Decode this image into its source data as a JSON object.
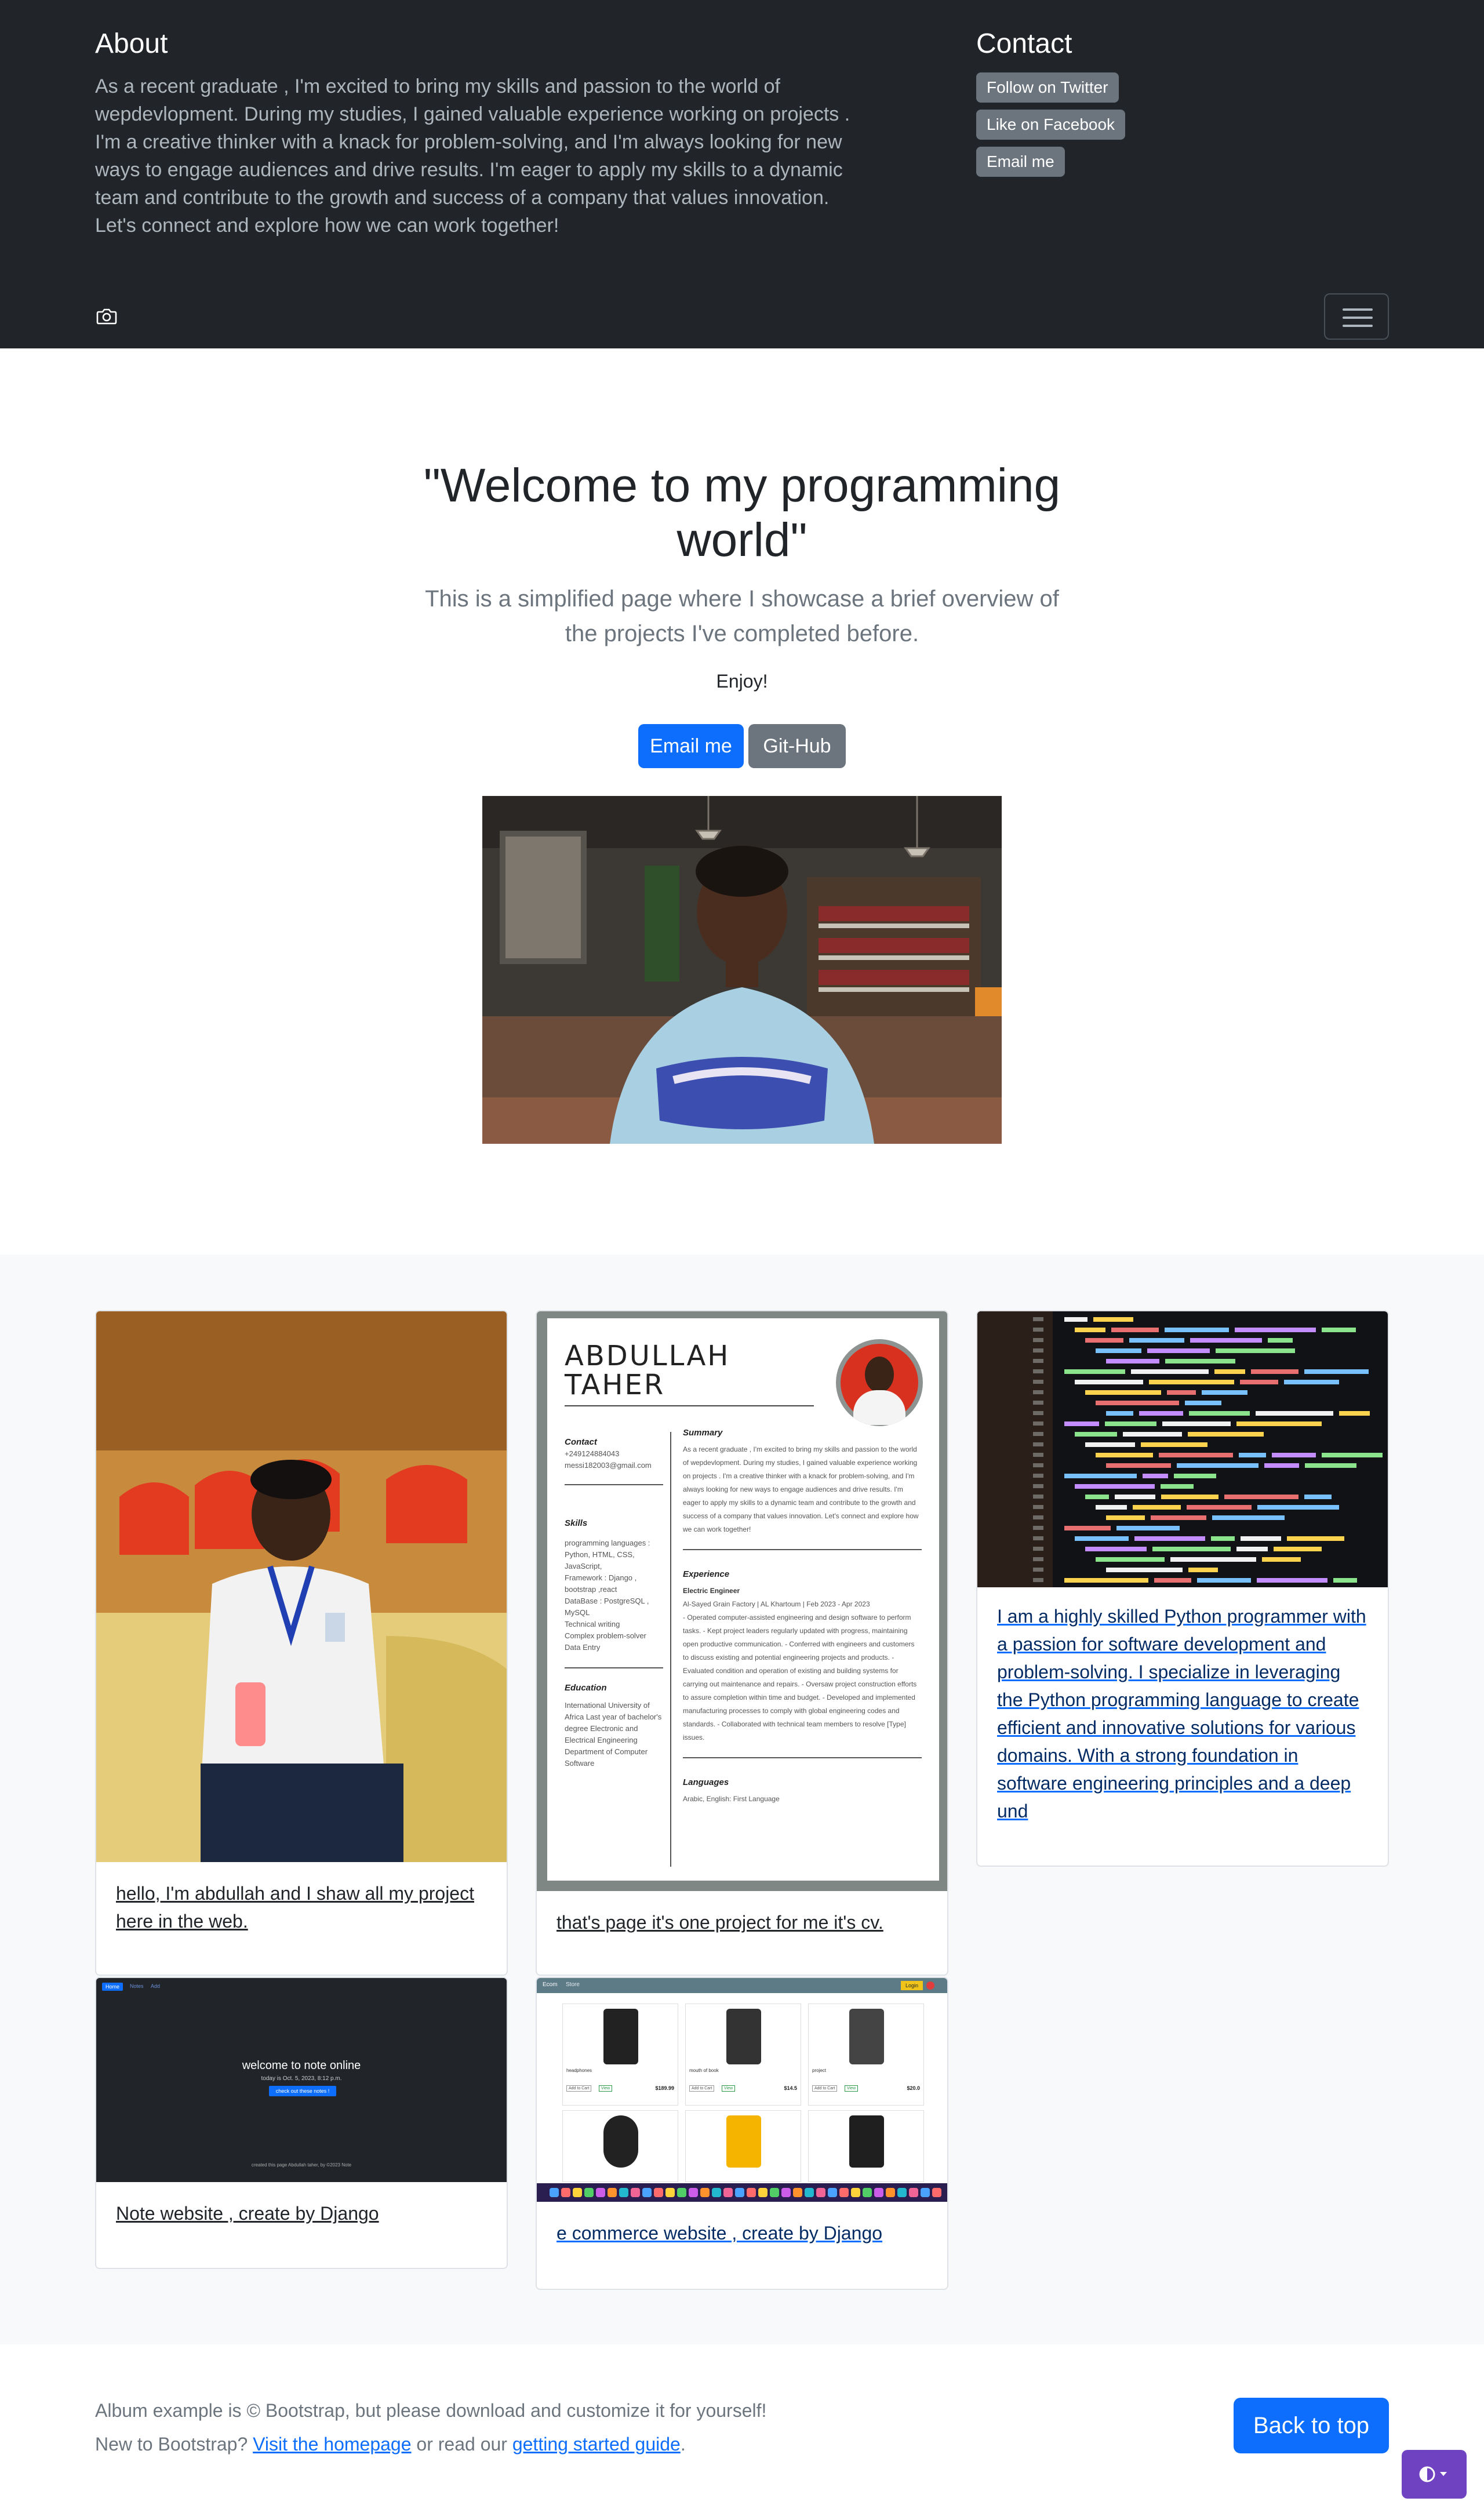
{
  "header": {
    "about_title": "About",
    "about_text": "As a recent graduate , I'm excited to bring my skills and passion to the world of wepdevlopment. During my studies, I gained valuable experience working on projects . I'm a creative thinker with a knack for problem-solving, and I'm always looking for new ways to engage audiences and drive results. I'm eager to apply my skills to a dynamic team and contribute to the growth and success of a company that values innovation. Let's connect and explore how we can work together!",
    "contact_title": "Contact",
    "contact_links": [
      "Follow on Twitter",
      "Like on Facebook",
      "Email me"
    ]
  },
  "hero": {
    "title": "\"Welcome to my programming world\"",
    "lead": "This is a simplified page where I showcase a brief overview of the projects I've completed before.",
    "enjoy": "Enjoy!",
    "email_button": "Email me",
    "github_button": "Git-Hub"
  },
  "cards": [
    {
      "text": "hello, I'm abdullah and I shaw all my project here in the web."
    },
    {
      "text": "that's page it's one project for me it's cv."
    },
    {
      "text": "I am a highly skilled Python programmer with a passion for software development and problem-solving. I specialize in leveraging the Python programming language to create efficient and innovative solutions for various domains. With a strong foundation in software engineering principles and a deep und"
    },
    {
      "text": "Note website , create by Django"
    },
    {
      "text": "e commerce website , create by Django"
    }
  ],
  "cv": {
    "name_line1": "ABDULLAH",
    "name_line2": "TAHER",
    "contact_h": "Contact",
    "contact_phone": "+249124884043",
    "contact_email": "messi182003@gmail.com",
    "skills_h": "Skills",
    "skills": [
      "programming languages : Python, HTML, CSS, JavaScript,",
      "Framework : Django , bootstrap ,react",
      "DataBase : PostgreSQL , MySQL",
      "Technical writing",
      "Complex problem-solver",
      "Data Entry"
    ],
    "education_h": "Education",
    "education": "International University of Africa Last year of bachelor's degree Electronic and Electrical Engineering Department of Computer Software",
    "summary_h": "Summary",
    "summary": "As a recent graduate , I'm excited to bring my skills and passion to the world of wepdevlopment. During my studies, I gained valuable experience working on projects . I'm a creative thinker with a knack for problem-solving, and I'm always looking for new ways to engage audiences and drive results. I'm eager to apply my skills to a dynamic team and contribute to the growth and success of a company that values innovation. Let's connect and explore how we can work together!",
    "experience_h": "Experience",
    "job_title": "Electric Engineer",
    "job_place": "Al-Sayed Grain Factory | AL Khartoum | Feb 2023 - Apr 2023",
    "job_points": "- Operated computer-assisted engineering and design software to perform tasks. - Kept project leaders regularly updated with progress, maintaining open productive communication. - Conferred with engineers and customers to discuss existing and potential engineering projects and products. - Evaluated condition and operation of existing and building systems for carrying out maintenance and repairs. - Oversaw project construction efforts to assure completion within time and budget. - Developed and implemented manufacturing processes to comply with global engineering codes and standards. - Collaborated with technical team members to resolve [Type] issues.",
    "languages_h": "Languages",
    "languages": "Arabic, English: First Language"
  },
  "note_site": {
    "nav": [
      "Home",
      "Notes",
      "Add"
    ],
    "title": "welcome to note online",
    "subtitle": "today is Oct. 5, 2023, 8:12 p.m.",
    "button": "check out these notes !",
    "footer": "created this page Abdullah taher, by ©2023 Note"
  },
  "shop": {
    "brand": "Ecom",
    "nav": "Store",
    "login": "Login",
    "products": [
      {
        "name": "headphones",
        "price": "$189.99"
      },
      {
        "name": "mouth of book",
        "price": "$14.5"
      },
      {
        "name": "project",
        "price": "$20.0"
      }
    ],
    "add_to_cart": "Add to Cart",
    "view": "View"
  },
  "footer": {
    "line1": "Album example is © Bootstrap, but please download and customize it for yourself!",
    "line2_prefix": "New to Bootstrap? ",
    "line2_link1": "Visit the homepage",
    "line2_mid": " or read our ",
    "line2_link2": "getting started guide",
    "line2_suffix": ".",
    "back_to_top": "Back to top"
  },
  "colors": {
    "primary": "#0d6efd",
    "secondary": "#6c757d",
    "dark": "#212529",
    "theme_toggle": "#6f42c1"
  }
}
